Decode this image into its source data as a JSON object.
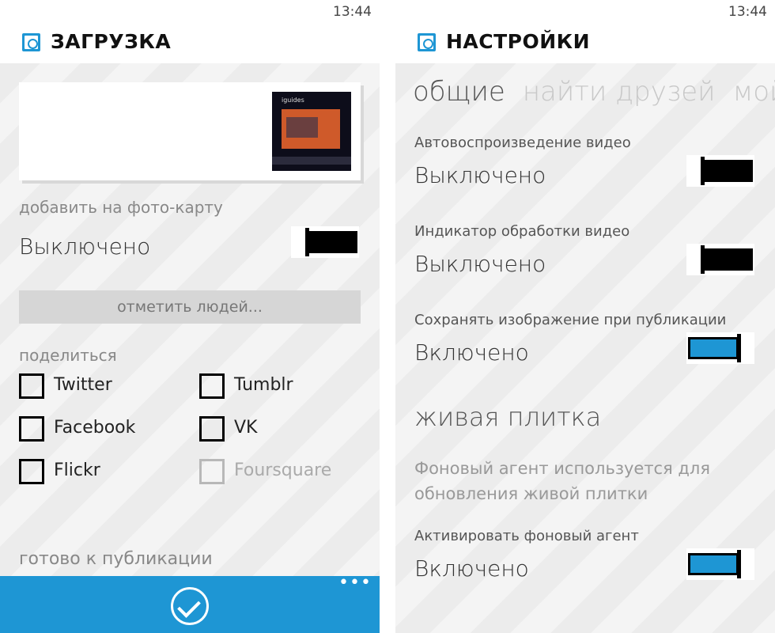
{
  "left": {
    "status_time": "13:44",
    "title": "ЗАГРУЗКА",
    "photo_thumbnail_text": "iguides",
    "add_to_map_label": "добавить на фото-карту",
    "add_to_map_value": "Выключено",
    "add_to_map_state": "off",
    "tag_people_button": "отметить людей...",
    "share_label": "поделиться",
    "share_options": [
      {
        "label": "Twitter",
        "checked": false,
        "enabled": true
      },
      {
        "label": "Tumblr",
        "checked": false,
        "enabled": true
      },
      {
        "label": "Facebook",
        "checked": false,
        "enabled": true
      },
      {
        "label": "VK",
        "checked": false,
        "enabled": true
      },
      {
        "label": "Flickr",
        "checked": false,
        "enabled": true
      },
      {
        "label": "Foursquare",
        "checked": false,
        "enabled": false
      }
    ],
    "ready_label": "готово к публикации",
    "appbar_more": "•••"
  },
  "right": {
    "status_time": "13:44",
    "title": "НАСТРОЙКИ",
    "pivot": [
      "общие",
      "найти друзей",
      "мой пр"
    ],
    "settings": [
      {
        "label": "Автовоспроизведение видео",
        "value": "Выключено",
        "state": "off"
      },
      {
        "label": "Индикатор обработки видео",
        "value": "Выключено",
        "state": "off"
      },
      {
        "label": "Сохранять изображение при публикации",
        "value": "Включено",
        "state": "on"
      }
    ],
    "live_tile_section": "живая плитка",
    "live_tile_desc": "Фоновый агент используется для обновления живой плитки",
    "bg_agent_label": "Активировать фоновый агент",
    "bg_agent_value": "Включено",
    "bg_agent_state": "on"
  },
  "colors": {
    "accent": "#1e96d4",
    "background": "#f2f2f2"
  }
}
